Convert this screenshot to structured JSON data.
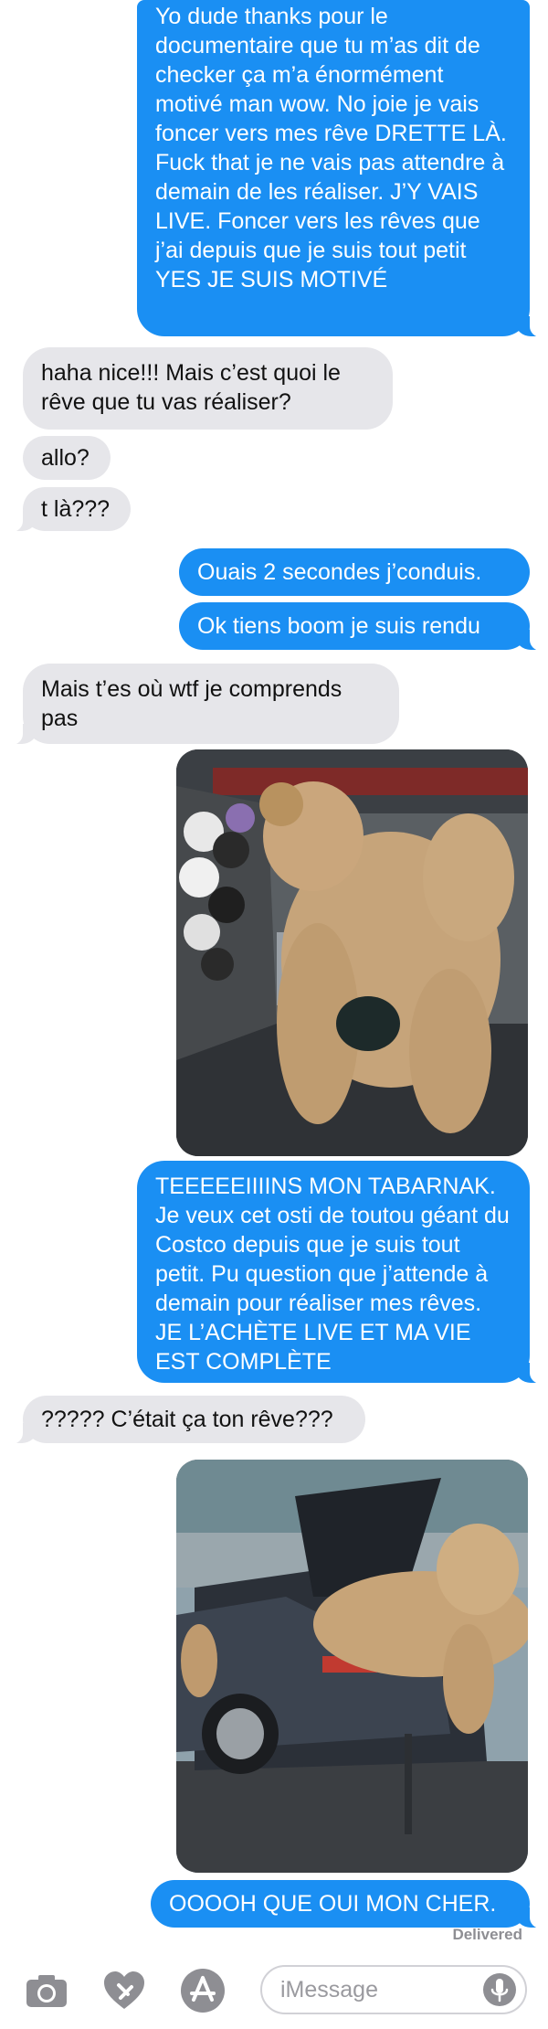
{
  "messages": [
    {
      "from": "me",
      "text": "Yo dude thanks pour le documentaire que tu m’as dit de checker ça m’a énormément motivé man wow. No joie je vais foncer vers mes rêve DRETTE LÀ. Fuck that je ne vais pas attendre à demain de les réaliser. J’Y VAIS LIVE. Foncer vers les rêves que j’ai depuis que je suis tout petit YES JE SUIS MOTIVÉ"
    },
    {
      "from": "them",
      "text": "haha nice!!! Mais c’est quoi le rêve que tu vas réaliser?"
    },
    {
      "from": "them",
      "text": "allo?"
    },
    {
      "from": "them",
      "text": "t là???"
    },
    {
      "from": "me",
      "text": "Ouais 2 secondes j’conduis."
    },
    {
      "from": "me",
      "text": "Ok tiens boom je suis rendu"
    },
    {
      "from": "them",
      "text": "Mais t’es où wtf je comprends pas"
    },
    {
      "from": "me",
      "text": "TEEEEEIIIINS MON TABARNAK. Je veux cet osti de toutou géant du Costco depuis que je suis tout petit. Pu question que j’attende à demain pour réaliser mes rêves. JE L’ACHÈTE LIVE ET MA VIE EST COMPLÈTE"
    },
    {
      "from": "them",
      "text": "????? C’était ça ton rêve???"
    },
    {
      "from": "me",
      "text": "OOOOH QUE OUI MON CHER."
    }
  ],
  "photos": [
    {
      "icon": "photo-teddy-bear-in-store"
    },
    {
      "icon": "photo-teddy-bear-in-car-trunk"
    }
  ],
  "status": {
    "delivered": "Delivered"
  },
  "composer": {
    "placeholder": "iMessage",
    "icons": [
      "camera-icon",
      "digital-touch-icon",
      "app-store-icon",
      "microphone-icon"
    ]
  },
  "colors": {
    "sent": "#1a8ff3",
    "received": "#e6e6ea",
    "background": "#ffffff"
  }
}
